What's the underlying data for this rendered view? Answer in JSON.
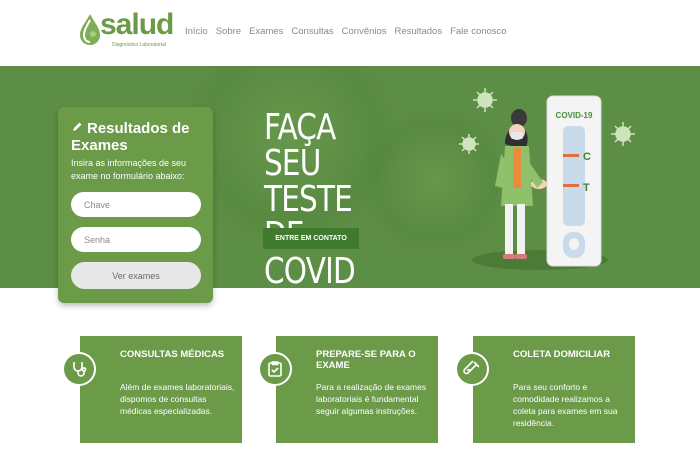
{
  "brand": {
    "name": "salud",
    "tagline": "Diagnóstico Laboratorial",
    "color": "#6b9a48"
  },
  "nav": {
    "items": [
      "Início",
      "Sobre",
      "Exames",
      "Consultas",
      "Convênios",
      "Resultados",
      "Fale conosco"
    ]
  },
  "hero": {
    "title": "FAÇA SEU TESTE DE COVID",
    "button_label": "ENTRE EM CONTATO",
    "test_label": "COVID-19",
    "test_c": "C",
    "test_t": "T",
    "background": "#5d8e45"
  },
  "results": {
    "title": "Resultados de Exames",
    "description": "Insira as informações de seu exame no formulário abaixo:",
    "key_placeholder": "Chave",
    "password_placeholder": "Senha",
    "submit_label": "Ver exames",
    "icon": "pencil-icon"
  },
  "features": [
    {
      "title": "CONSULTAS MÉDICAS",
      "text": "Além de exames laboratoriais, dispomos de consultas médicas especializadas.",
      "icon": "stethoscope-icon"
    },
    {
      "title": "PREPARE-SE PARA O EXAME",
      "text": "Para a realização de exames laboratoriais é fundamental seguir algumas instruções.",
      "icon": "checklist-icon"
    },
    {
      "title": "COLETA DOMICILIAR",
      "text": "Para seu conforto e comodidade realizamos a coleta para exames em sua residência.",
      "icon": "test-tube-icon"
    }
  ]
}
